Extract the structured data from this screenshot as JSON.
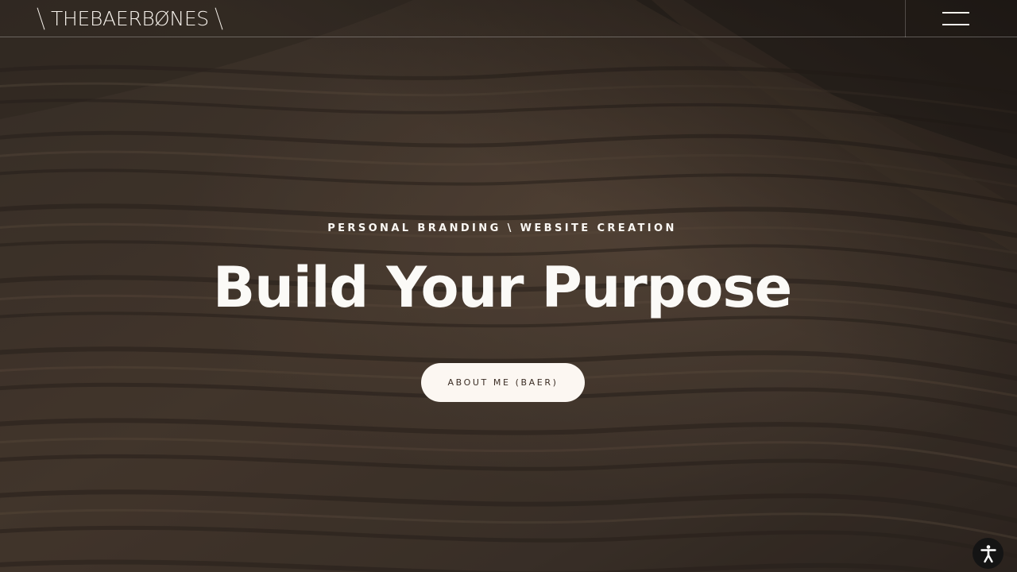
{
  "header": {
    "logo_text": "THEBAERBØNES",
    "menu_icon": "hamburger-menu-icon"
  },
  "hero": {
    "eyebrow": "PERSONAL BRANDING \\ WEBSITE CREATION",
    "headline": "Build Your Purpose",
    "cta_label": "ABOUT ME (BAER)"
  },
  "accessibility": {
    "icon": "accessibility-icon"
  },
  "colors": {
    "background": "#3a3029",
    "text_light": "#fbfaf7",
    "button_bg": "#fcf7f2",
    "button_text": "#3b2d24",
    "accessibility_bg": "#141414"
  }
}
